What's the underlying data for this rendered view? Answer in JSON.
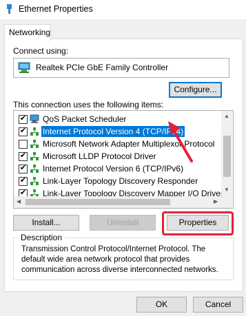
{
  "window": {
    "title": "Ethernet Properties"
  },
  "tabs": [
    {
      "label": "Networking"
    }
  ],
  "connect": {
    "label": "Connect using:",
    "adapter_name": "Realtek PCIe GbE Family Controller",
    "configure_label": "Configure..."
  },
  "items_section": {
    "label": "This connection uses the following items:",
    "items": [
      {
        "label": "QoS Packet Scheduler",
        "checked": true,
        "icon": "qos-scheduler-icon"
      },
      {
        "label": "Internet Protocol Version 4 (TCP/IPv4)",
        "checked": true,
        "selected": true,
        "icon": "protocol-icon"
      },
      {
        "label": "Microsoft Network Adapter Multiplexor Protocol",
        "checked": false,
        "icon": "protocol-icon"
      },
      {
        "label": "Microsoft LLDP Protocol Driver",
        "checked": true,
        "icon": "protocol-icon"
      },
      {
        "label": "Internet Protocol Version 6 (TCP/IPv6)",
        "checked": true,
        "icon": "protocol-icon"
      },
      {
        "label": "Link-Layer Topology Discovery Responder",
        "checked": true,
        "icon": "protocol-icon"
      },
      {
        "label": "Link-Layer Topology Discovery Mapper I/O Driver",
        "checked": true,
        "icon": "protocol-icon"
      }
    ]
  },
  "actions": {
    "install_label": "Install...",
    "uninstall_label": "Uninstall",
    "properties_label": "Properties"
  },
  "description": {
    "legend": "Description",
    "text": "Transmission Control Protocol/Internet Protocol. The default wide area network protocol that provides communication across diverse interconnected networks."
  },
  "footer": {
    "ok_label": "OK",
    "cancel_label": "Cancel"
  },
  "colors": {
    "selection": "#0078d7",
    "annotation": "#e3203a"
  }
}
